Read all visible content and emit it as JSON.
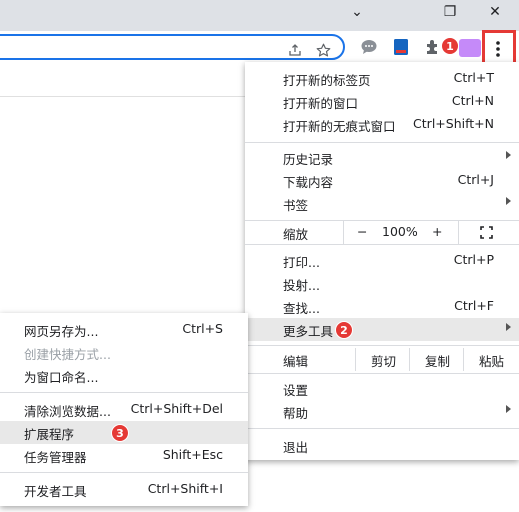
{
  "window_controls": {
    "minimize": "⌄",
    "restore": "❐",
    "close": "✕"
  },
  "toolbar": {
    "share_icon": "share-icon",
    "star_icon": "star-icon",
    "extensions_badge": "1",
    "menu_icon": "more-vert-icon"
  },
  "main_menu": {
    "new_tab": {
      "label": "打开新的标签页",
      "shortcut": "Ctrl+T"
    },
    "new_window": {
      "label": "打开新的窗口",
      "shortcut": "Ctrl+N"
    },
    "new_incognito": {
      "label": "打开新的无痕式窗口",
      "shortcut": "Ctrl+Shift+N"
    },
    "history": {
      "label": "历史记录"
    },
    "downloads": {
      "label": "下载内容",
      "shortcut": "Ctrl+J"
    },
    "bookmarks": {
      "label": "书签"
    },
    "zoom": {
      "label": "缩放",
      "minus": "−",
      "value": "100%",
      "plus": "+"
    },
    "print": {
      "label": "打印...",
      "shortcut": "Ctrl+P"
    },
    "cast": {
      "label": "投射..."
    },
    "find": {
      "label": "查找...",
      "shortcut": "Ctrl+F"
    },
    "more_tools": {
      "label": "更多工具",
      "badge": "2"
    },
    "edit": {
      "label": "编辑",
      "cut": "剪切",
      "copy": "复制",
      "paste": "粘贴"
    },
    "settings": {
      "label": "设置"
    },
    "help": {
      "label": "帮助"
    },
    "exit": {
      "label": "退出"
    }
  },
  "submenu": {
    "save_page": {
      "label": "网页另存为...",
      "shortcut": "Ctrl+S"
    },
    "create_shortcut": {
      "label": "创建快捷方式..."
    },
    "name_window": {
      "label": "为窗口命名..."
    },
    "clear_data": {
      "label": "清除浏览数据...",
      "shortcut": "Ctrl+Shift+Del"
    },
    "extensions": {
      "label": "扩展程序",
      "badge": "3"
    },
    "task_manager": {
      "label": "任务管理器",
      "shortcut": "Shift+Esc"
    },
    "dev_tools": {
      "label": "开发者工具",
      "shortcut": "Ctrl+Shift+I"
    }
  },
  "colors": {
    "accent": "#1a73e8",
    "badge": "#e53935",
    "highlight": "#e8e8e8",
    "extension_purple": "#c58af9"
  }
}
